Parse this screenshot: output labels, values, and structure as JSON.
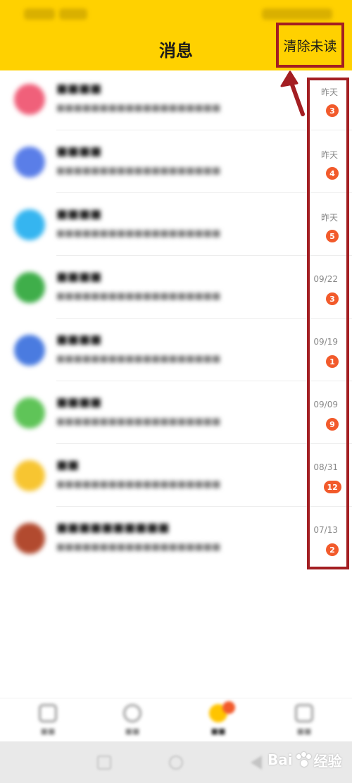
{
  "header": {
    "title": "消息",
    "clear_unread_label": "清除未读",
    "background": "#ffd100"
  },
  "annotation_color": "#a31e22",
  "messages": [
    {
      "title": "■■■■",
      "preview": "■■■■■■■■■■■■■■■■■■■",
      "time": "昨天",
      "badge": "3",
      "avatar_color": "#f0607a"
    },
    {
      "title": "■■■■",
      "preview": "■■■■■■■■■■■■■■■■■■■",
      "time": "昨天",
      "badge": "4",
      "avatar_color": "#5a7ee8"
    },
    {
      "title": "■■■■",
      "preview": "■■■■■■■■■■■■■■■■■■■",
      "time": "昨天",
      "badge": "5",
      "avatar_color": "#35b5f0"
    },
    {
      "title": "■■■■",
      "preview": "■■■■■■■■■■■■■■■■■■■",
      "time": "09/22",
      "badge": "3",
      "avatar_color": "#3fae4a"
    },
    {
      "title": "■■■■",
      "preview": "■■■■■■■■■■■■■■■■■■■",
      "time": "09/19",
      "badge": "1",
      "avatar_color": "#4a7be0"
    },
    {
      "title": "■■■■",
      "preview": "■■■■■■■■■■■■■■■■■■■",
      "time": "09/09",
      "badge": "9",
      "avatar_color": "#5fc458"
    },
    {
      "title": "■■",
      "preview": "■■■■■■■■■■■■■■■■■■■",
      "time": "08/31",
      "badge": "12",
      "avatar_color": "#f7c531"
    },
    {
      "title": "■■■■■■■■■■",
      "preview": "■■■■■■■■■■■■■■■■■■■",
      "time": "07/13",
      "badge": "2",
      "avatar_color": "#b24a2f"
    }
  ],
  "badge_color": "#f25a2b",
  "bottom_nav": {
    "items": [
      {
        "label": "■■",
        "icon": "home-icon"
      },
      {
        "label": "■■",
        "icon": "discover-icon"
      },
      {
        "label": "■■",
        "icon": "message-icon"
      },
      {
        "label": "■■",
        "icon": "profile-icon"
      }
    ],
    "active_index": 2
  },
  "watermark": {
    "text_left": "Bai",
    "text_right": "经验"
  }
}
